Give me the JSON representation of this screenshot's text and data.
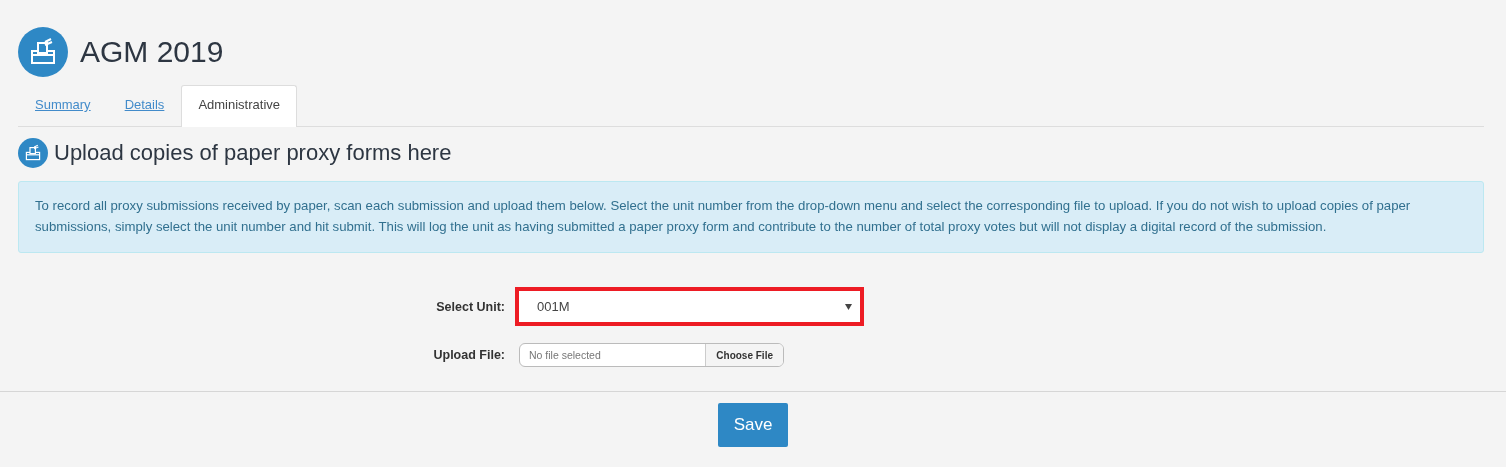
{
  "page": {
    "title": "AGM 2019"
  },
  "tabs": [
    {
      "label": "Summary",
      "selected": false
    },
    {
      "label": "Details",
      "selected": false
    },
    {
      "label": "Administrative",
      "selected": true
    }
  ],
  "section": {
    "heading": "Upload copies of paper proxy forms here",
    "info": "To record all proxy submissions received by paper, scan each submission and upload them below. Select the unit number from the drop-down menu and select the corresponding file to upload. If you do not wish to upload copies of paper submissions, simply select the unit number and hit submit. This will log the unit as having submitted a paper proxy form and contribute to the number of total proxy votes but will not display a digital record of the submission."
  },
  "form": {
    "unit_label": "Select Unit:",
    "unit_value": "001M",
    "unit_highlighted": true,
    "file_label": "Upload File:",
    "file_status": "No file selected",
    "file_button": "Choose File"
  },
  "footer": {
    "save_button": "Save"
  }
}
